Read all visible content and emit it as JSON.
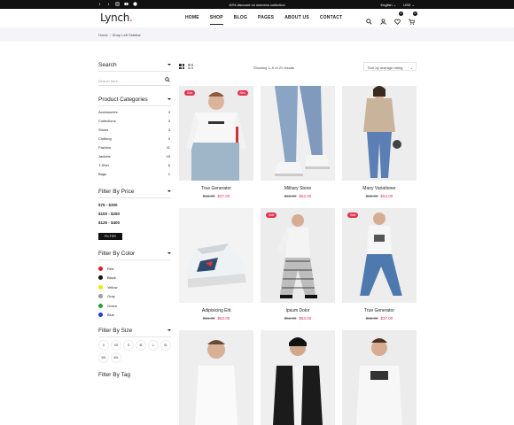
{
  "topbar": {
    "socials": [
      "f",
      "t",
      "ig",
      "yt",
      "p"
    ],
    "promo": "40% discount on womens collection",
    "language": "English ⌄",
    "currency": "USD ⌄"
  },
  "header": {
    "logo": "Lynch",
    "logo_dot": ".",
    "nav": [
      "HOME",
      "SHOP",
      "BLOG",
      "PAGES",
      "ABOUT US",
      "CONTACT"
    ],
    "active_nav": "SHOP",
    "wishlist_count": "0",
    "cart_count": "0"
  },
  "breadcrumb": {
    "home": "Home",
    "sep": "/",
    "current": "Shop Left Sidebar"
  },
  "sidebar": {
    "search_title": "Search",
    "search_placeholder": "Search here...",
    "categories_title": "Product Categories",
    "categories": [
      {
        "name": "Accessories",
        "count": "3"
      },
      {
        "name": "Collections",
        "count": "3"
      },
      {
        "name": "Shoes",
        "count": "3"
      },
      {
        "name": "Clothing",
        "count": "0"
      },
      {
        "name": "Fashion",
        "count": "11"
      },
      {
        "name": "Jackets",
        "count": "15"
      },
      {
        "name": "T-Shirt",
        "count": "6"
      },
      {
        "name": "Bags",
        "count": "1"
      }
    ],
    "price_title": "Filter By Price",
    "prices": [
      "$75 - $300",
      "$100 - $250",
      "$125 - $400"
    ],
    "filter_button": "FILTER",
    "color_title": "Filter By Color",
    "colors": [
      {
        "name": "Red",
        "hex": "#e21e2b"
      },
      {
        "name": "Black",
        "hex": "#111111"
      },
      {
        "name": "Yellow",
        "hex": "#f2e600"
      },
      {
        "name": "Gray",
        "hex": "#9a9a9a"
      },
      {
        "name": "Green",
        "hex": "#2e9b3a"
      },
      {
        "name": "Blue",
        "hex": "#1f3ad6"
      }
    ],
    "size_title": "Filter By Size",
    "sizes": [
      "X",
      "XS",
      "S",
      "M",
      "L",
      "XL",
      "3XL",
      "4XL"
    ],
    "next_title": "Filter By Tag"
  },
  "toolbar": {
    "showing": "Showing 1–9 of 21 results",
    "sort": "Sort by average rating"
  },
  "products": [
    {
      "name": "True Generator",
      "old": "$62.00",
      "price": "$37.00",
      "sale": "Sale",
      "new": "New"
    },
    {
      "name": "Military Stone",
      "old": "$69.00",
      "price": "$62.00",
      "sale": "",
      "new": ""
    },
    {
      "name": "Many Variationer",
      "old": "$62.00",
      "price": "$53.00",
      "sale": "",
      "new": ""
    },
    {
      "name": "Adipisicing Elit",
      "old": "$56.00",
      "price": "$63.00",
      "sale": "",
      "new": ""
    },
    {
      "name": "Ipsum Dolor",
      "old": "$56.00",
      "price": "$53.00",
      "sale": "Sale",
      "new": ""
    },
    {
      "name": "True Generator",
      "old": "$62.00",
      "price": "$37.00",
      "sale": "Sale",
      "new": ""
    }
  ],
  "colors": {
    "accent": "#e2324f",
    "dark": "#111111"
  }
}
